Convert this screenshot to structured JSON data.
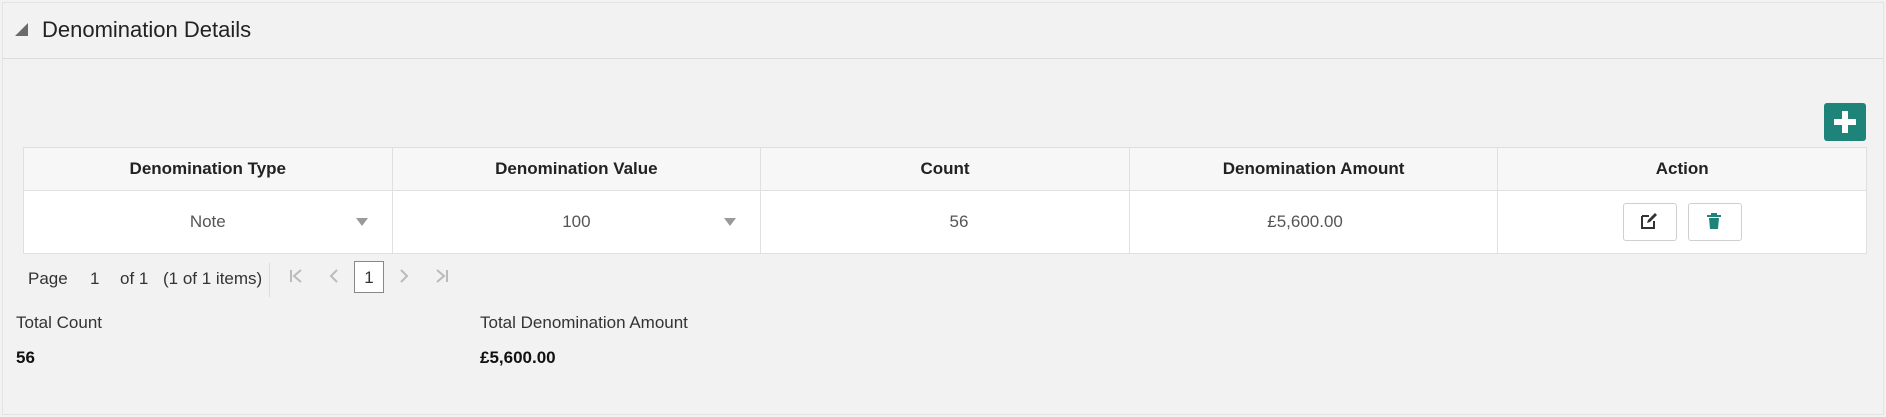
{
  "section": {
    "title": "Denomination Details"
  },
  "table": {
    "columns": [
      "Denomination Type",
      "Denomination Value",
      "Count",
      "Denomination Amount",
      "Action"
    ],
    "rows": [
      {
        "type": "Note",
        "value": "100",
        "count": "56",
        "amount": "£5,600.00"
      }
    ]
  },
  "pager": {
    "page_label": "Page",
    "page_number": "1",
    "of_label": "of 1",
    "items_label": "(1 of 1 items)",
    "current_page": "1"
  },
  "summary": {
    "total_count_label": "Total Count",
    "total_count_value": "56",
    "total_amount_label": "Total Denomination Amount",
    "total_amount_value": "£5,600.00"
  },
  "icons": {
    "add": "plus-icon",
    "edit": "edit-icon",
    "delete": "trash-icon",
    "collapse": "triangle-collapse-icon"
  },
  "colors": {
    "accent": "#1e8378"
  }
}
